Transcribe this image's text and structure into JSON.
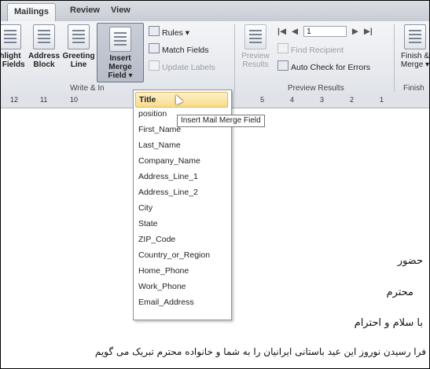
{
  "tabs": [
    "Mailings",
    "Review",
    "View"
  ],
  "ribbon": {
    "highlight_fields": [
      "hlight",
      "e Fields"
    ],
    "address_block": [
      "Address",
      "Block"
    ],
    "greeting_line": [
      "Greeting",
      "Line"
    ],
    "insert_merge_field": [
      "Insert Merge",
      "Field"
    ],
    "rules": "Rules",
    "match_fields": "Match Fields",
    "update_labels": "Update Labels",
    "write_insert_group": "Write & In",
    "preview_results": [
      "Preview",
      "Results"
    ],
    "record_number": "1",
    "find_recipient": "Find Recipient",
    "auto_check": "Auto Check for Errors",
    "preview_group": "Preview Results",
    "finish_merge": [
      "Finish &",
      "Merge"
    ],
    "finish_group": "Finish"
  },
  "ruler": {
    "left_marks": [
      "12",
      "11",
      "10"
    ],
    "right_marks": [
      "5",
      "4",
      "3",
      "2",
      "1"
    ]
  },
  "dropdown": {
    "items": [
      "Title",
      "position",
      "First_Name",
      "Last_Name",
      "Company_Name",
      "Address_Line_1",
      "Address_Line_2",
      "City",
      "State",
      "ZIP_Code",
      "Country_or_Region",
      "Home_Phone",
      "Work_Phone",
      "Email_Address"
    ]
  },
  "tooltip": "Insert Mail Merge Field",
  "document": {
    "line1": "حضور",
    "line2": "محترم",
    "line3": "با سلام و احترام",
    "line4": "فرا رسیدن نوروز این عید باستانی ایرانیان را به شما و خانواده محترم تبریک می گویم"
  }
}
